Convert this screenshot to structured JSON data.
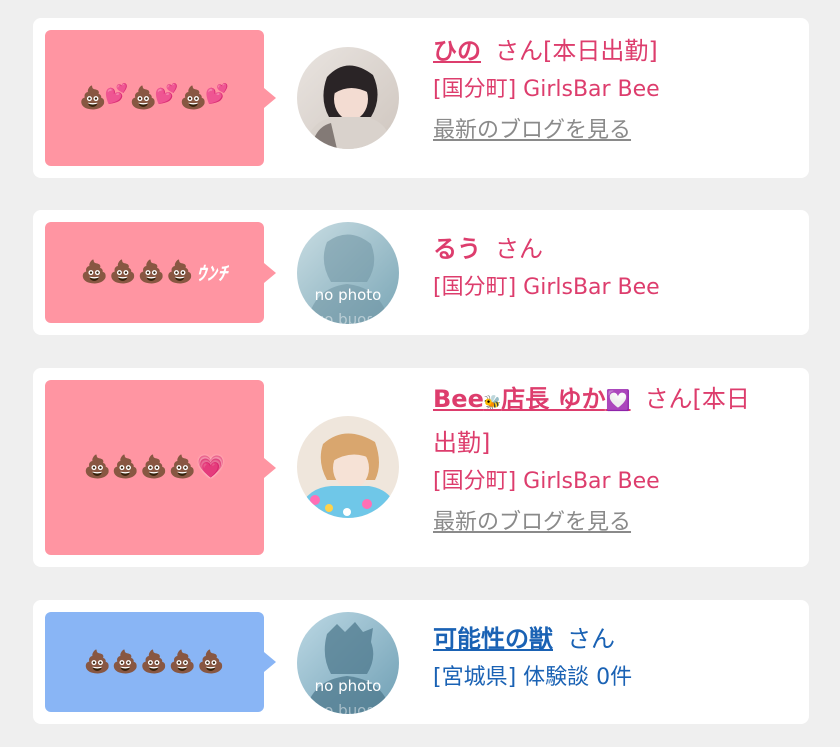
{
  "entries": [
    {
      "bubble_color": "pink",
      "rating_icons": [
        "poop-icon",
        "heart-icon",
        "poop-icon",
        "heart-icon",
        "poop-icon",
        "heart-icon"
      ],
      "avatar": "photo",
      "name": "ひの",
      "suffix": "さん[本日出勤]",
      "shop": "[国分町] GirlsBar Bee",
      "blog_link": "最新のブログを見る"
    },
    {
      "bubble_color": "pink",
      "rating_icons": [
        "poop-icon",
        "poop-icon",
        "poop-icon",
        "poop-icon"
      ],
      "rating_text": "ｳﾝﾁ",
      "avatar": "no-photo",
      "avatar_text": "no photo",
      "name": "るう",
      "suffix": "さん",
      "shop": "[国分町] GirlsBar Bee"
    },
    {
      "bubble_color": "pink",
      "rating_icons": [
        "poop-icon",
        "poop-icon",
        "poop-icon",
        "poop-icon",
        "pink-heart-icon"
      ],
      "avatar": "photo",
      "name_prefix": "Bee",
      "name": "店長 ゆか",
      "suffix": "さん[本日",
      "suffix2": "出勤]",
      "shop": "[国分町] GirlsBar Bee",
      "blog_link": "最新のブログを見る"
    },
    {
      "bubble_color": "blue",
      "rating_icons": [
        "poop-icon",
        "poop-icon",
        "poop-icon",
        "poop-icon",
        "poop-icon"
      ],
      "avatar": "no-photo",
      "avatar_text": "no photo",
      "name": "可能性の獣",
      "suffix": "さん",
      "shop": "[宮城県] 体験談 0件"
    }
  ],
  "colors": {
    "pink_bubble": "#ff95a2",
    "blue_bubble": "#89b5f5",
    "name_pink": "#dd3d6d",
    "name_blue": "#1a62b4",
    "link_gray": "#8a8a8a"
  }
}
